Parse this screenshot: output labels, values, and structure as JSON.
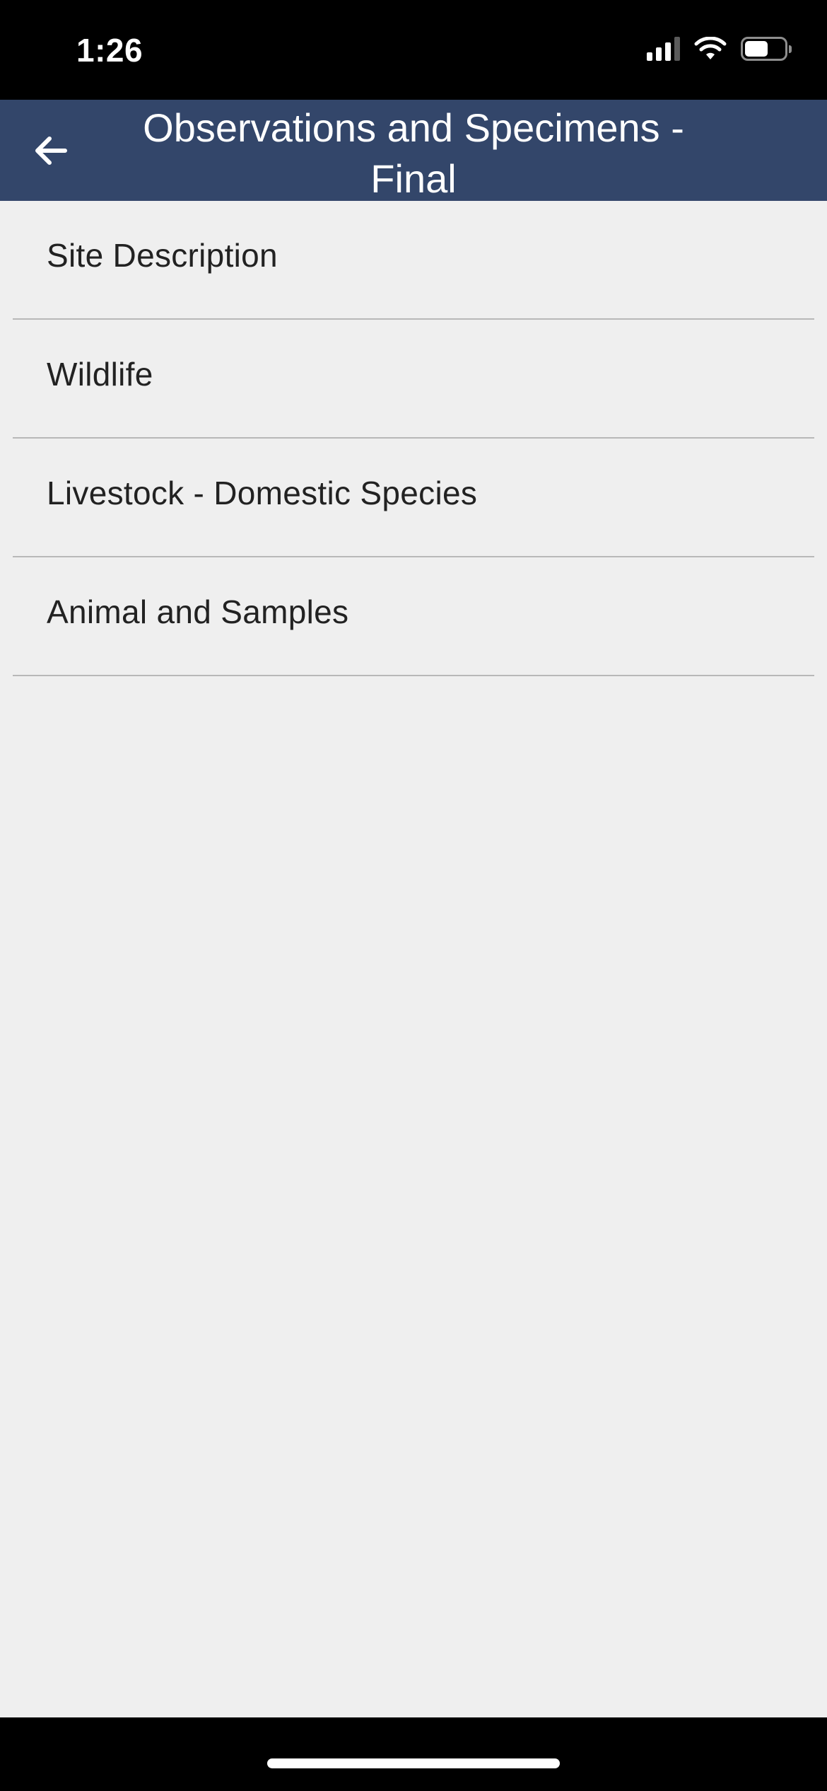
{
  "status_bar": {
    "time": "1:26",
    "signal_icon": "cellular-signal-icon",
    "wifi_icon": "wifi-icon",
    "battery_icon": "battery-icon",
    "battery_level": 0.6
  },
  "header": {
    "title": "Observations and Specimens - Final",
    "back_icon": "arrow-left-icon",
    "background_color": "#33466a"
  },
  "menu": {
    "items": [
      {
        "label": "Site Description"
      },
      {
        "label": "Wildlife"
      },
      {
        "label": "Livestock - Domestic Species"
      },
      {
        "label": "Animal and Samples"
      }
    ]
  }
}
